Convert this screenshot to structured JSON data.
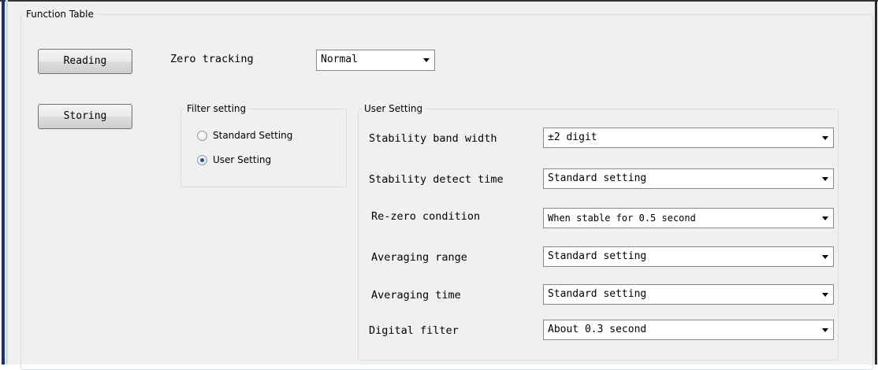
{
  "function_table": {
    "title": "Function Table",
    "buttons": {
      "reading": "Reading",
      "storing": "Storing"
    },
    "zero_tracking": {
      "label": "Zero tracking",
      "value": "Normal"
    },
    "filter_setting": {
      "title": "Filter setting",
      "options": [
        "Standard Setting",
        "User Setting"
      ],
      "selected": "User Setting"
    },
    "user_setting": {
      "title": "User Setting",
      "rows": [
        {
          "label": "Stability band width",
          "value": "±2 digit"
        },
        {
          "label": "Stability detect time",
          "value": "Standard setting"
        },
        {
          "label": "Re-zero condition",
          "value": "When stable for 0.5 second"
        },
        {
          "label": "Averaging range",
          "value": "Standard setting"
        },
        {
          "label": "Averaging time",
          "value": "Standard setting"
        },
        {
          "label": "Digital filter",
          "value": "About 0.3 second"
        }
      ]
    }
  },
  "colors": {
    "panel_bg": "#f0f0f0",
    "groupbox_border": "#d5dfe5",
    "frame_left": "#1c2f66",
    "radio_selected": "#1b4f9a"
  }
}
